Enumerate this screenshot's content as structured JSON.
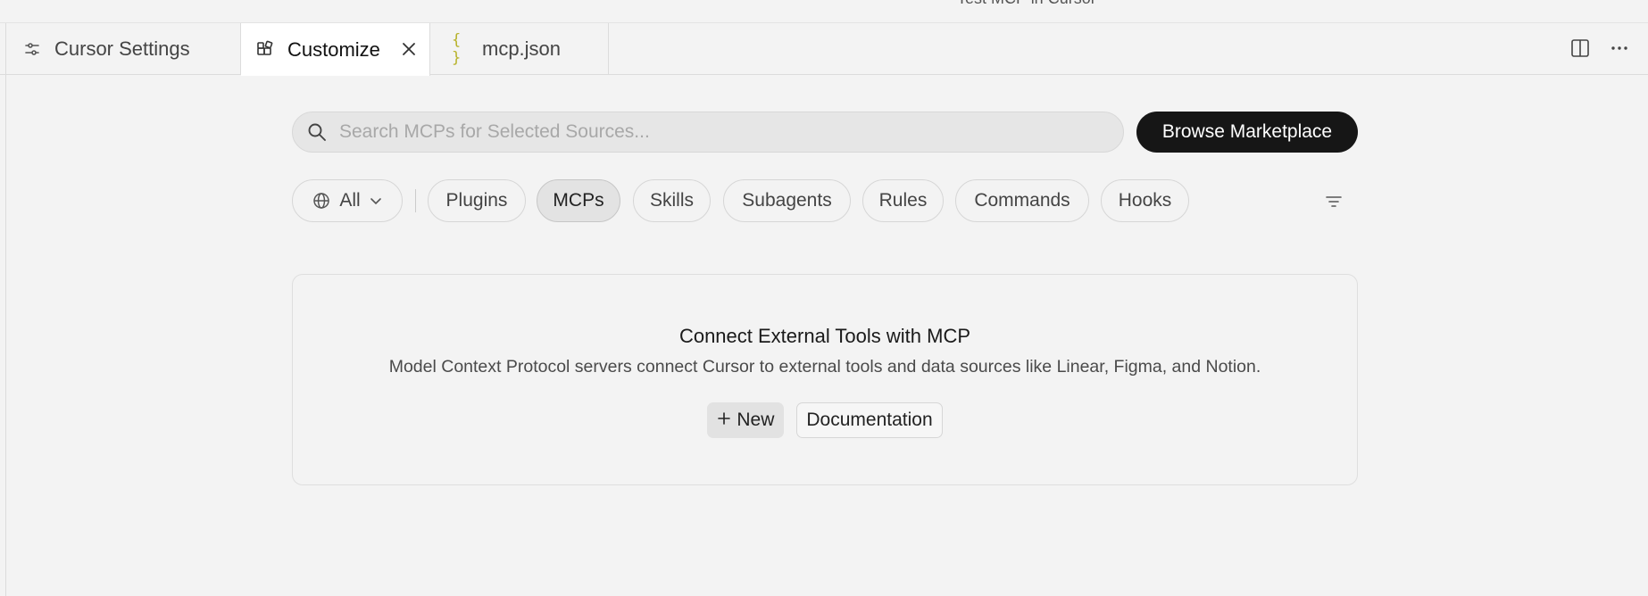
{
  "window": {
    "title": "Test MCP in Cursor"
  },
  "tabs": [
    {
      "label": "Cursor Settings",
      "icon": "sliders-icon"
    },
    {
      "label": "Customize",
      "icon": "blocks-icon",
      "active": true
    },
    {
      "label": "mcp.json",
      "icon": "json-braces-icon",
      "icon_glyph": "{ }"
    }
  ],
  "toolbar": {
    "split_editor_icon": "split-editor-icon",
    "more_icon": "more-actions-icon"
  },
  "search": {
    "placeholder": "Search MCPs for Selected Sources...",
    "value": ""
  },
  "browse_button": {
    "label": "Browse  Marketplace"
  },
  "source_filter": {
    "label": "All"
  },
  "chips": [
    {
      "label": "Plugins",
      "active": false
    },
    {
      "label": "MCPs",
      "active": true
    },
    {
      "label": "Skills",
      "active": false
    },
    {
      "label": "Subagents",
      "active": false
    },
    {
      "label": "Rules",
      "active": false
    },
    {
      "label": "Commands",
      "active": false
    },
    {
      "label": "Hooks",
      "active": false
    }
  ],
  "empty_state": {
    "title": "Connect External Tools with MCP",
    "description": "Model Context Protocol servers connect Cursor to external tools and data sources like Linear, Figma, and Notion.",
    "new_button": "New",
    "docs_button": "Documentation"
  },
  "colors": {
    "accent_dark": "#161616",
    "json_icon": "#b7b22a",
    "background": "#f3f3f3"
  }
}
